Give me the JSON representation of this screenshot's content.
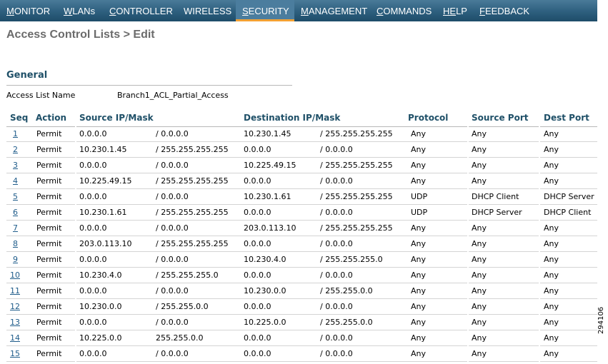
{
  "nav": {
    "items": [
      {
        "first": "M",
        "rest": "ONITOR",
        "name": "nav-monitor"
      },
      {
        "first": "W",
        "rest": "LANs",
        "name": "nav-wlans"
      },
      {
        "first": "C",
        "rest": "ONTROLLER",
        "name": "nav-controller"
      },
      {
        "first": "W",
        "rest": "IRELESS",
        "name": "nav-wireless",
        "pre": ""
      },
      {
        "first": "S",
        "rest": "ECURITY",
        "name": "nav-security",
        "active": true
      },
      {
        "first": "M",
        "rest": "ANAGEMENT",
        "name": "nav-management"
      },
      {
        "first": "C",
        "rest": "OMMANDS",
        "name": "nav-commands"
      },
      {
        "first": "HE",
        "rest": "LP",
        "name": "nav-help"
      },
      {
        "first": "F",
        "rest": "EEDBACK",
        "name": "nav-feedback"
      }
    ],
    "colors": {
      "bar": "#2d5f7e",
      "active": "#4b7d9e",
      "active_underline": "#f3a133"
    }
  },
  "page": {
    "title": "Access Control Lists > Edit",
    "section": "General",
    "access_list_name_label": "Access List Name",
    "access_list_name_value": "Branch1_ACL_Partial_Access"
  },
  "table": {
    "headers": [
      "Seq",
      "Action",
      "Source IP/Mask",
      "Destination IP/Mask",
      "Protocol",
      "Source Port",
      "Dest Port"
    ],
    "rows": [
      [
        "1",
        "Permit",
        "0.0.0.0",
        "/ 0.0.0.0",
        "10.230.1.45",
        "/ 255.255.255.255",
        "Any",
        "Any",
        "Any"
      ],
      [
        "2",
        "Permit",
        "10.230.1.45",
        "/ 255.255.255.255",
        "0.0.0.0",
        "/ 0.0.0.0",
        "Any",
        "Any",
        "Any"
      ],
      [
        "3",
        "Permit",
        "0.0.0.0",
        "/ 0.0.0.0",
        "10.225.49.15",
        "/ 255.255.255.255",
        "Any",
        "Any",
        "Any"
      ],
      [
        "4",
        "Permit",
        "10.225.49.15",
        "/ 255.255.255.255",
        "0.0.0.0",
        "/ 0.0.0.0",
        "Any",
        "Any",
        "Any"
      ],
      [
        "5",
        "Permit",
        "0.0.0.0",
        "/ 0.0.0.0",
        "10.230.1.61",
        "/ 255.255.255.255",
        "UDP",
        "DHCP Client",
        "DHCP Server"
      ],
      [
        "6",
        "Permit",
        "10.230.1.61",
        "/ 255.255.255.255",
        "0.0.0.0",
        "/ 0.0.0.0",
        "UDP",
        "DHCP Server",
        "DHCP Client"
      ],
      [
        "7",
        "Permit",
        "0.0.0.0",
        "/ 0.0.0.0",
        "203.0.113.10",
        "/ 255.255.255.255",
        "Any",
        "Any",
        "Any"
      ],
      [
        "8",
        "Permit",
        "203.0.113.10",
        "/ 255.255.255.255",
        "0.0.0.0",
        "/ 0.0.0.0",
        "Any",
        "Any",
        "Any"
      ],
      [
        "9",
        "Permit",
        "0.0.0.0",
        "/ 0.0.0.0",
        "10.230.4.0",
        "/ 255.255.255.0",
        "Any",
        "Any",
        "Any"
      ],
      [
        "10",
        "Permit",
        "10.230.4.0",
        "/ 255.255.255.0",
        "0.0.0.0",
        "/ 0.0.0.0",
        "Any",
        "Any",
        "Any"
      ],
      [
        "11",
        "Permit",
        "0.0.0.0",
        "/ 0.0.0.0",
        "10.230.0.0",
        "/ 255.255.0.0",
        "Any",
        "Any",
        "Any"
      ],
      [
        "12",
        "Permit",
        "10.230.0.0",
        "/ 255.255.0.0",
        "0.0.0.0",
        "/ 0.0.0.0",
        "Any",
        "Any",
        "Any"
      ],
      [
        "13",
        "Permit",
        "0.0.0.0",
        "/ 0.0.0.0",
        "10.225.0.0",
        "/ 255.255.0.0",
        "Any",
        "Any",
        "Any"
      ],
      [
        "14",
        "Permit",
        "10.225.0.0",
        "255.255.0.0",
        "0.0.0.0",
        "/ 0.0.0.0",
        "Any",
        "Any",
        "Any"
      ],
      [
        "15",
        "Permit",
        "0.0.0.0",
        "/ 0.0.0.0",
        "0.0.0.0",
        "/ 0.0.0.0",
        "Any",
        "Any",
        "Any"
      ]
    ]
  },
  "figure_id": "294106"
}
